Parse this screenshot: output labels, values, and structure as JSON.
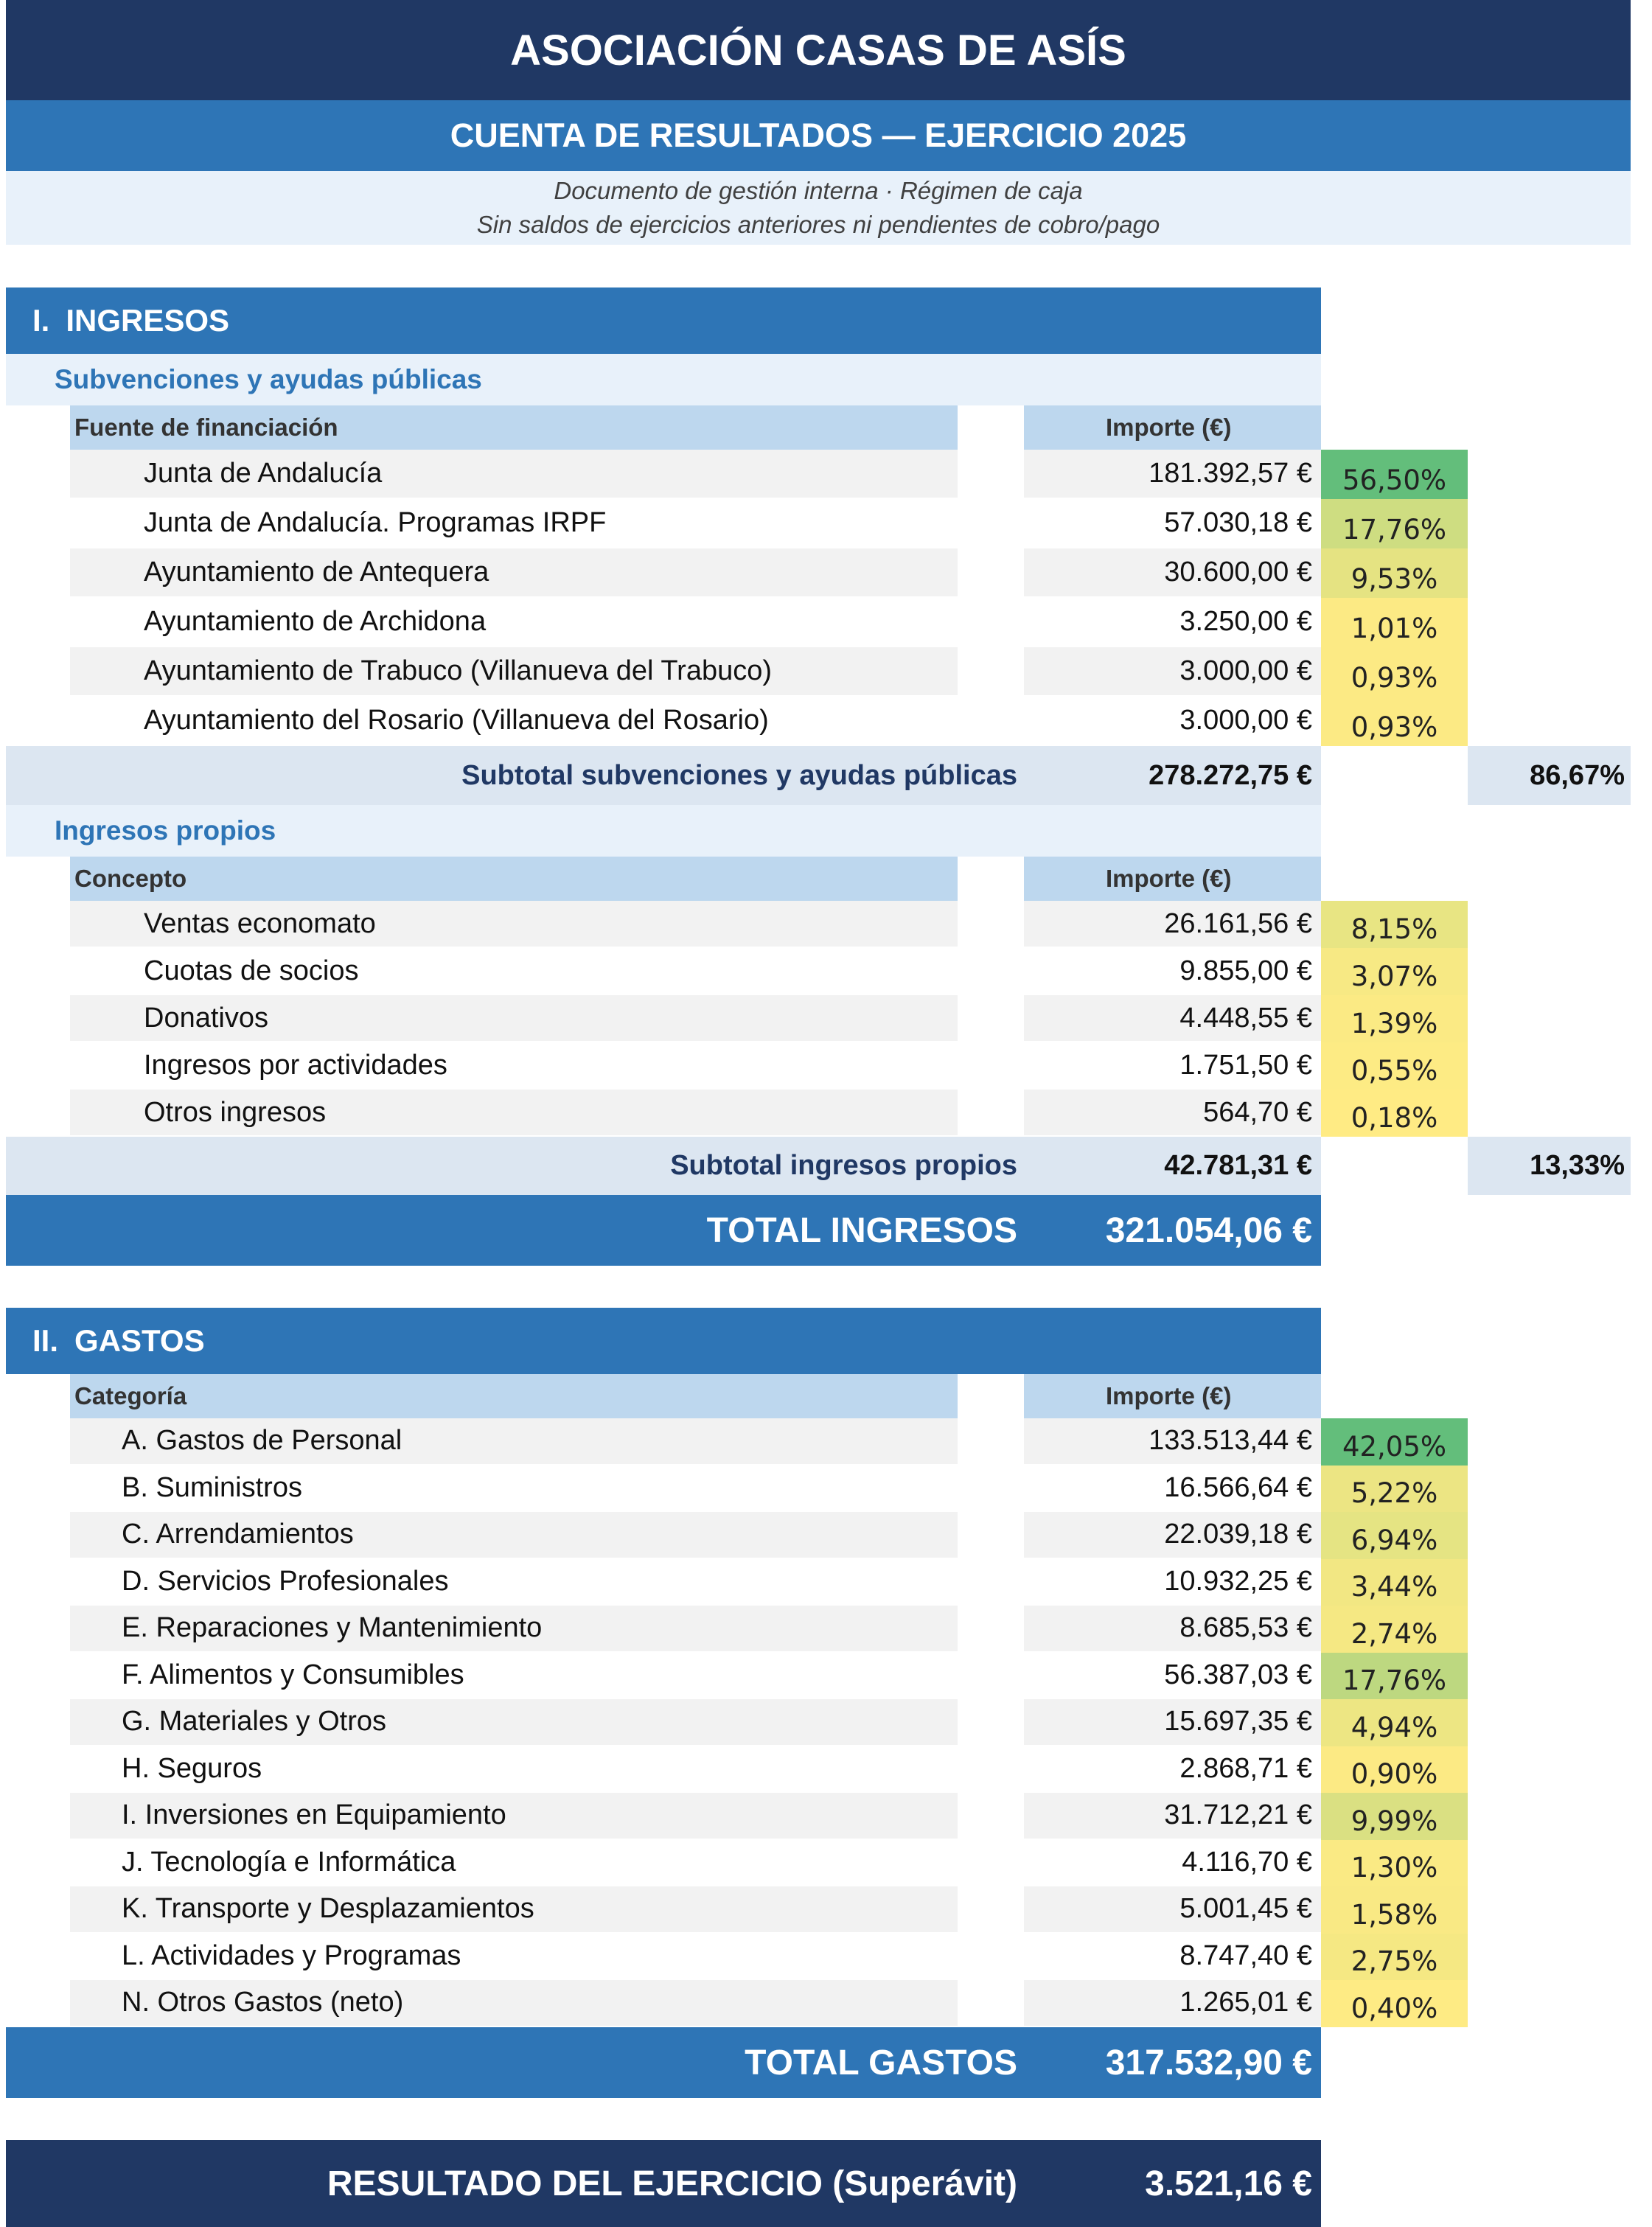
{
  "header": {
    "title": "ASOCIACIÓN CASAS DE ASÍS",
    "subtitle": "CUENTA DE RESULTADOS — EJERCICIO 2025",
    "note_line1": "Documento de gestión interna · Régimen de caja",
    "note_line2": "Sin saldos de ejercicios anteriores ni pendientes de cobro/pago"
  },
  "ingresos": {
    "num": "I.",
    "title": "INGRESOS",
    "subvenciones": {
      "title": "Subvenciones y ayudas públicas",
      "col_label": "Fuente de financiación",
      "col_amount": "Importe (€)",
      "rows": [
        {
          "label": "Junta de Andalucía",
          "amount": "181.392,57 €",
          "pct": "56,50%",
          "share": 0.565
        },
        {
          "label": "Junta de Andalucía. Programas IRPF",
          "amount": "57.030,18 €",
          "pct": "17,76%",
          "share": 0.1776
        },
        {
          "label": "Ayuntamiento de Antequera",
          "amount": "30.600,00 €",
          "pct": "9,53%",
          "share": 0.0953
        },
        {
          "label": "Ayuntamiento de Archidona",
          "amount": "3.250,00 €",
          "pct": "1,01%",
          "share": 0.0101
        },
        {
          "label": "Ayuntamiento de Trabuco (Villanueva del Trabuco)",
          "amount": "3.000,00 €",
          "pct": "0,93%",
          "share": 0.0093
        },
        {
          "label": "Ayuntamiento del Rosario (Villanueva del Rosario)",
          "amount": "3.000,00 €",
          "pct": "0,93%",
          "share": 0.0093
        }
      ],
      "subtotal_label": "Subtotal subvenciones y ayudas públicas",
      "subtotal_amount": "278.272,75 €",
      "subtotal_pct": "86,67%"
    },
    "propios": {
      "title": "Ingresos propios",
      "col_label": "Concepto",
      "col_amount": "Importe (€)",
      "rows": [
        {
          "label": "Ventas economato",
          "amount": "26.161,56 €",
          "pct": "8,15%",
          "share": 0.0815
        },
        {
          "label": "Cuotas de socios",
          "amount": "9.855,00 €",
          "pct": "3,07%",
          "share": 0.0307
        },
        {
          "label": "Donativos",
          "amount": "4.448,55 €",
          "pct": "1,39%",
          "share": 0.0139
        },
        {
          "label": "Ingresos por actividades",
          "amount": "1.751,50 €",
          "pct": "0,55%",
          "share": 0.0055
        },
        {
          "label": "Otros ingresos",
          "amount": "564,70 €",
          "pct": "0,18%",
          "share": 0.0018
        }
      ],
      "subtotal_label": "Subtotal ingresos propios",
      "subtotal_amount": "42.781,31 €",
      "subtotal_pct": "13,33%"
    },
    "total_label": "TOTAL INGRESOS",
    "total_amount": "321.054,06 €"
  },
  "gastos": {
    "num": "II.",
    "title": "GASTOS",
    "col_label": "Categoría",
    "col_amount": "Importe (€)",
    "rows": [
      {
        "label": "A. Gastos de Personal",
        "amount": "133.513,44 €",
        "pct": "42,05%",
        "share": 0.4205
      },
      {
        "label": "B. Suministros",
        "amount": "16.566,64 €",
        "pct": "5,22%",
        "share": 0.0522
      },
      {
        "label": "C. Arrendamientos",
        "amount": "22.039,18 €",
        "pct": "6,94%",
        "share": 0.0694
      },
      {
        "label": "D. Servicios Profesionales",
        "amount": "10.932,25 €",
        "pct": "3,44%",
        "share": 0.0344
      },
      {
        "label": "E. Reparaciones y Mantenimiento",
        "amount": "8.685,53 €",
        "pct": "2,74%",
        "share": 0.0274
      },
      {
        "label": "F. Alimentos y Consumibles",
        "amount": "56.387,03 €",
        "pct": "17,76%",
        "share": 0.1776
      },
      {
        "label": "G. Materiales y Otros",
        "amount": "15.697,35 €",
        "pct": "4,94%",
        "share": 0.0494
      },
      {
        "label": "H. Seguros",
        "amount": "2.868,71 €",
        "pct": "0,90%",
        "share": 0.009
      },
      {
        "label": "I. Inversiones en Equipamiento",
        "amount": "31.712,21 €",
        "pct": "9,99%",
        "share": 0.0999
      },
      {
        "label": "J. Tecnología e Informática",
        "amount": "4.116,70 €",
        "pct": "1,30%",
        "share": 0.013
      },
      {
        "label": "K. Transporte y Desplazamientos",
        "amount": "5.001,45 €",
        "pct": "1,58%",
        "share": 0.0158
      },
      {
        "label": "L. Actividades y Programas",
        "amount": "8.747,40 €",
        "pct": "2,75%",
        "share": 0.0275
      },
      {
        "label": "N. Otros Gastos (neto)",
        "amount": "1.265,01 €",
        "pct": "0,40%",
        "share": 0.004
      }
    ],
    "total_label": "TOTAL GASTOS",
    "total_amount": "317.532,90 €"
  },
  "resultado": {
    "label": "RESULTADO DEL EJERCICIO  (Superávit)",
    "amount": "3.521,16 €"
  },
  "colors": {
    "dark_navy": "#203864",
    "blue": "#2e75b6",
    "light_blue": "#e8f1fa",
    "col_header": "#bdd7ee",
    "subtotal": "#dce6f1",
    "scale_high": "#63be7b",
    "scale_mid": "#ffeb84"
  }
}
